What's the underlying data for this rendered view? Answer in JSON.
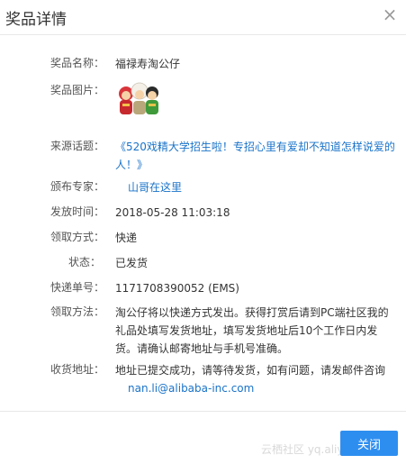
{
  "dialog": {
    "title": "奖品详情",
    "close_icon": "×"
  },
  "fields": {
    "prize_name": {
      "label": "奖品名称：",
      "value": "福禄寿淘公仔"
    },
    "prize_image": {
      "label": "奖品图片："
    },
    "source_topic": {
      "label": "来源话题：",
      "value": "《520戏精大学招生啦！专招心里有爱却不知道怎样说爱的人！》"
    },
    "awarded_by": {
      "label": "颁布专家：",
      "value": "山哥在这里"
    },
    "issue_time": {
      "label": "发放时间：",
      "value": "2018-05-28 11:03:18"
    },
    "claim_method": {
      "label": "领取方式：",
      "value": "快递"
    },
    "status": {
      "label": "状态：",
      "value": "已发货"
    },
    "tracking_no": {
      "label": "快递单号：",
      "value": "1171708390052 (EMS)"
    },
    "claim_instructions": {
      "label": "领取方法：",
      "value": "淘公仔将以快递方式发出。获得打赏后请到PC端社区我的礼品处填写发货地址，填写发货地址后10个工作日内发货。请确认邮寄地址与手机号准确。"
    },
    "shipping_address": {
      "label": "收货地址：",
      "value": "地址已提交成功，请等待发货，如有问题，请发邮件咨询",
      "email": "nan.li@alibaba-inc.com"
    }
  },
  "footer": {
    "close_button": "关闭",
    "watermark": "云栖社区 yq.aliyun.com"
  },
  "colors": {
    "primary": "#2e8ef0",
    "link": "#1a73c8"
  }
}
